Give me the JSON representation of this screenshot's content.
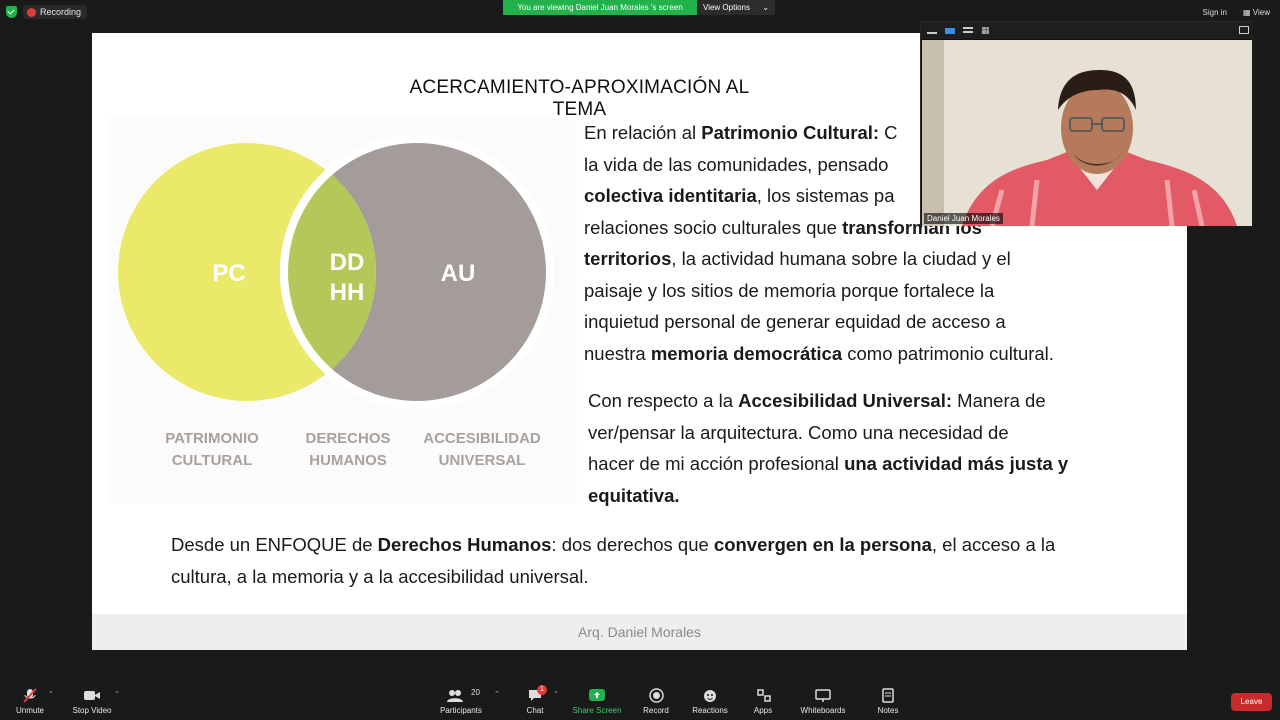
{
  "top": {
    "recording": "Recording",
    "viewing_banner": "You are viewing Daniel Juan Morales 's screen",
    "view_options": "View Options",
    "sign_in": "Sign in",
    "view": "View"
  },
  "slide": {
    "title": "ACERCAMIENTO-APROXIMACIÓN AL TEMA",
    "venn": {
      "pc": "PC",
      "ddhh_1": "DD",
      "ddhh_2": "HH",
      "au": "AU",
      "label_pc_1": "PATRIMONIO",
      "label_pc_2": "CULTURAL",
      "label_dh_1": "DERECHOS",
      "label_dh_2": "HUMANOS",
      "label_au_1": "ACCESIBILIDAD",
      "label_au_2": "UNIVERSAL",
      "colors": {
        "pc": "#ebe96a",
        "dh": "#b4c85a",
        "au": "#a49c98"
      }
    },
    "para1": {
      "t1": "En relación al ",
      "b1": "Patrimonio Cultural:",
      "t2": " C",
      "line2": "la vida de las comunidades, pensado",
      "b2": "colectiva identitaria",
      "t3": ", los sistemas pa",
      "t4": "relaciones socio culturales que ",
      "b3": "transforman los",
      "b4": "territorios",
      "t5": ", la actividad humana sobre la ciudad y el",
      "line6": "paisaje y los sitios de memoria porque fortalece la",
      "line7": "inquietud personal de generar equidad de acceso a",
      "t6": "nuestra ",
      "b5": "memoria democrática",
      "t7": " como patrimonio cultural."
    },
    "para2": {
      "t1": "Con respecto a la ",
      "b1": "Accesibilidad Universal:",
      "t2": " Manera de",
      "line2": "ver/pensar la arquitectura. Como una necesidad de",
      "t3": "hacer de mi acción profesional ",
      "b2": "una actividad más justa y",
      "b3": "equitativa."
    },
    "para3": {
      "t1": "Desde un ENFOQUE de ",
      "b1": "Derechos Humanos",
      "t2": ": dos derechos que ",
      "b2": "convergen en la persona",
      "t3": ", el acceso a la",
      "line2": "cultura, a la memoria y a la accesibilidad universal."
    },
    "footer": "Arq. Daniel Morales"
  },
  "video": {
    "name": "Daniel Juan Morales"
  },
  "toolbar": {
    "unmute": "Unmute",
    "stop_video": "Stop Video",
    "participants": "Participants",
    "participants_count": "20",
    "chat": "Chat",
    "chat_badge": "1",
    "share_screen": "Share Screen",
    "record": "Record",
    "reactions": "Reactions",
    "apps": "Apps",
    "whiteboards": "Whiteboards",
    "notes": "Notes",
    "leave": "Leave"
  }
}
